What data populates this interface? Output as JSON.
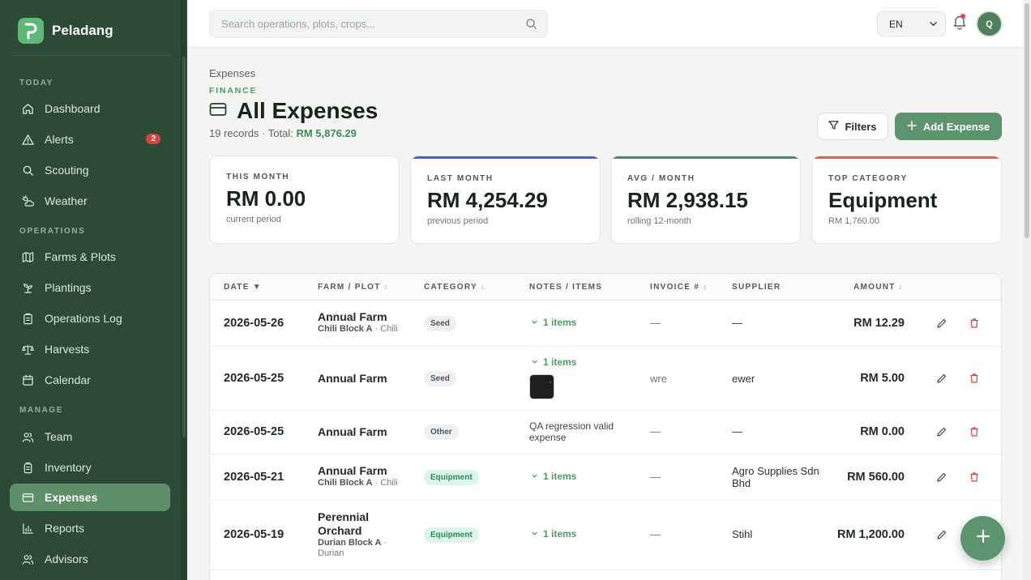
{
  "app": {
    "name": "Peladang"
  },
  "sidebar": {
    "sections": [
      {
        "label": "TODAY"
      },
      {
        "label": "OPERATIONS"
      },
      {
        "label": "MANAGE"
      }
    ],
    "items": [
      {
        "label": "Dashboard",
        "icon": "home-icon"
      },
      {
        "label": "Alerts",
        "icon": "alert-triangle-icon",
        "badge": "2"
      },
      {
        "label": "Scouting",
        "icon": "search-icon"
      },
      {
        "label": "Weather",
        "icon": "cloud-sun-icon"
      },
      {
        "label": "Farms & Plots",
        "icon": "map-icon"
      },
      {
        "label": "Plantings",
        "icon": "sprout-icon"
      },
      {
        "label": "Operations Log",
        "icon": "clipboard-icon"
      },
      {
        "label": "Harvests",
        "icon": "scale-icon"
      },
      {
        "label": "Calendar",
        "icon": "calendar-icon"
      },
      {
        "label": "Team",
        "icon": "users-icon"
      },
      {
        "label": "Inventory",
        "icon": "box-icon"
      },
      {
        "label": "Expenses",
        "icon": "wallet-icon",
        "active": true
      },
      {
        "label": "Reports",
        "icon": "bar-chart-icon"
      },
      {
        "label": "Advisors",
        "icon": "users-icon"
      }
    ]
  },
  "topbar": {
    "search_placeholder": "Search operations, plots, crops...",
    "language": "EN",
    "avatar_initial": "Q"
  },
  "header": {
    "breadcrumb": "Expenses",
    "eyebrow": "FINANCE",
    "title": "All Expenses",
    "records_text": "19 records · Total:",
    "total": "RM 5,876.29",
    "filters_label": "Filters",
    "add_label": "Add Expense"
  },
  "stats": [
    {
      "label": "THIS MONTH",
      "value": "RM 0.00",
      "sub": "current period",
      "accent": ""
    },
    {
      "label": "LAST MONTH",
      "value": "RM 4,254.29",
      "sub": "previous period",
      "accent": "#3f63d8"
    },
    {
      "label": "AVG / MONTH",
      "value": "RM 2,938.15",
      "sub": "rolling 12-month",
      "accent": "#3f8a7a"
    },
    {
      "label": "TOP CATEGORY",
      "value": "Equipment",
      "sub": "RM 1,760.00",
      "accent": "#e0663a"
    }
  ],
  "table": {
    "columns": {
      "date": "DATE",
      "date_sort": "▼",
      "farm": "FARM / PLOT",
      "category": "CATEGORY",
      "notes": "NOTES / ITEMS",
      "invoice": "INVOICE #",
      "supplier": "SUPPLIER",
      "amount": "AMOUNT",
      "sort_glyph": "↕"
    },
    "rows": [
      {
        "date": "2026-05-26",
        "farm": "Annual Farm",
        "plot": "Chili Block A",
        "crop": " · Chili",
        "category": "Seed",
        "items": "1 items",
        "invoice": "—",
        "supplier": "—",
        "amount": "RM 12.29"
      },
      {
        "date": "2026-05-25",
        "farm": "Annual Farm",
        "category": "Seed",
        "items": "1 items",
        "invoice": "wre",
        "supplier": "ewer",
        "amount": "RM 5.00"
      },
      {
        "date": "2026-05-25",
        "farm": "Annual Farm",
        "category": "Other",
        "notes": "QA regression valid expense",
        "invoice": "—",
        "supplier": "—",
        "amount": "RM 0.00"
      },
      {
        "date": "2026-05-21",
        "farm": "Annual Farm",
        "plot": "Chili Block A",
        "crop": " · Chili",
        "category": "Equipment",
        "items": "1 items",
        "invoice": "—",
        "supplier": "Agro Supplies Sdn Bhd",
        "amount": "RM 560.00"
      },
      {
        "date": "2026-05-19",
        "farm": "Perennial Orchard",
        "plot": "Durian Block A",
        "crop": " · Durian",
        "category": "Equipment",
        "items": "1 items",
        "invoice": "—",
        "supplier": "Stihl",
        "amount": "RM 1,200.00"
      }
    ]
  },
  "colors": {
    "sidebar": "#2d4a37",
    "accent": "#5d9470",
    "danger": "#d9443a"
  }
}
